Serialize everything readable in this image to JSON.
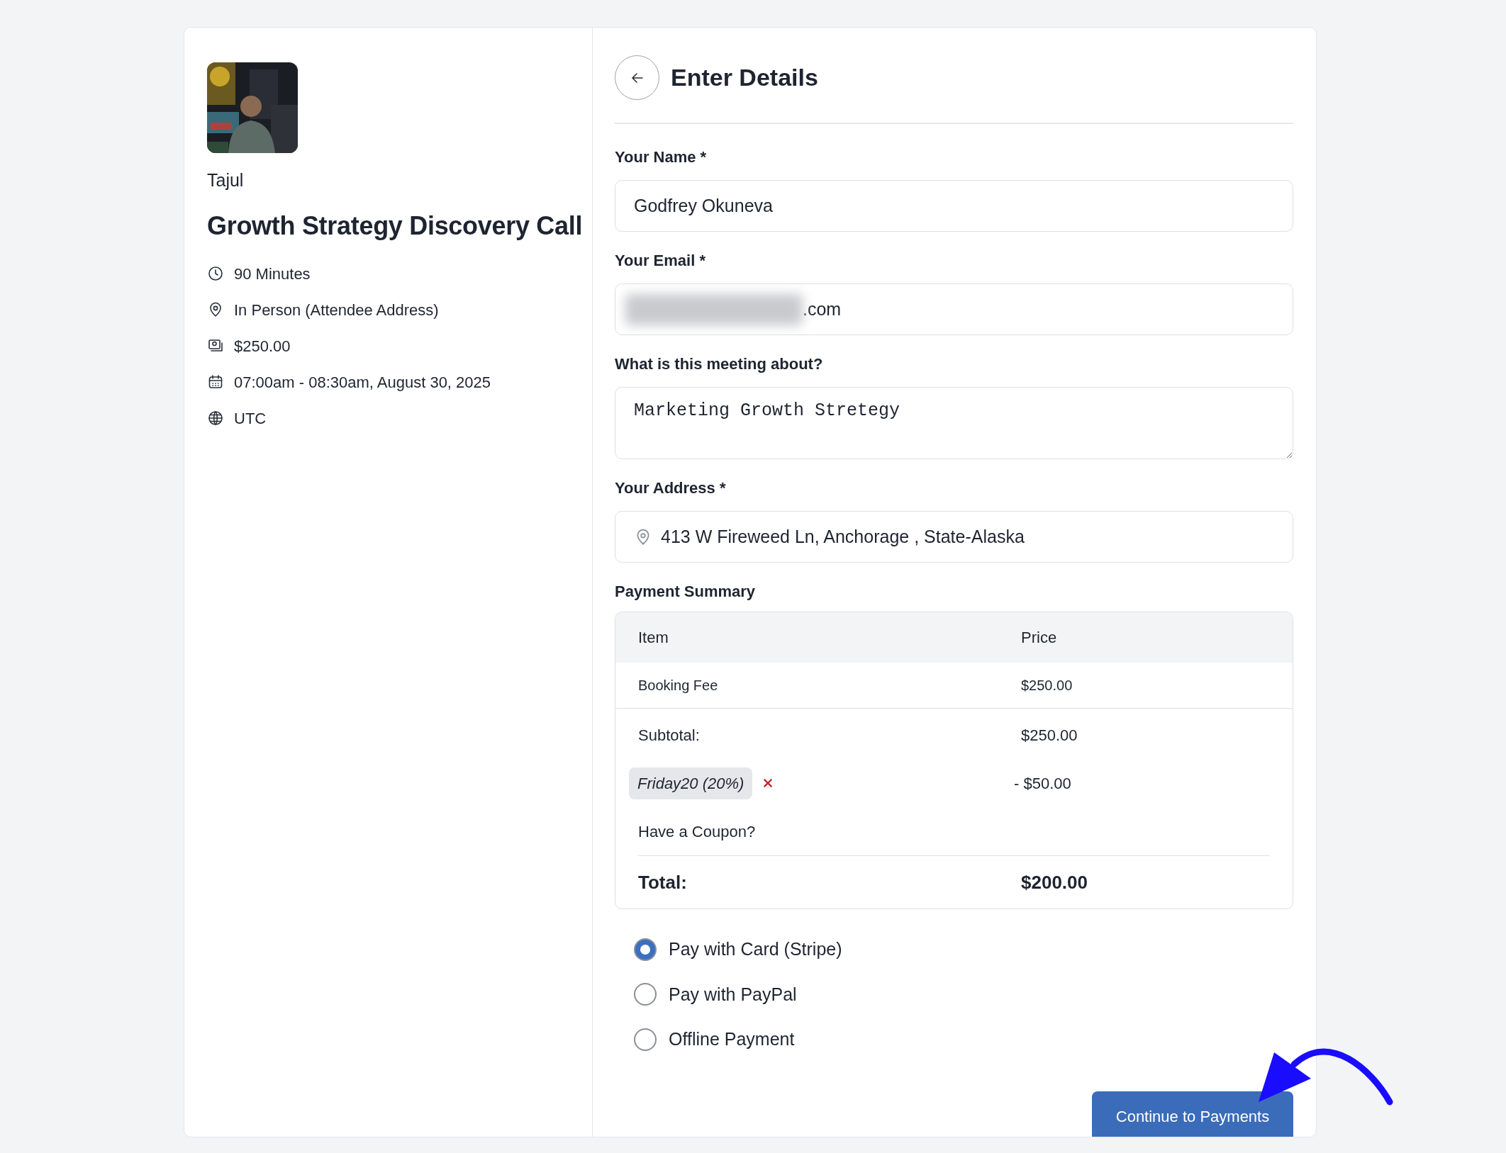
{
  "host": {
    "name": "Tajul"
  },
  "event": {
    "title": "Growth Strategy Discovery Call",
    "details": [
      {
        "kind": "duration",
        "text": "90 Minutes"
      },
      {
        "kind": "location",
        "text": "In Person (Attendee Address)"
      },
      {
        "kind": "price",
        "text": "$250.00"
      },
      {
        "kind": "date",
        "text": "07:00am - 08:30am, August 30, 2025"
      },
      {
        "kind": "timezone",
        "text": "UTC"
      }
    ]
  },
  "form": {
    "title": "Enter Details",
    "fields": [
      {
        "kind": "input",
        "label": "Your Name *",
        "value": "Godfrey Okuneva"
      },
      {
        "kind": "input",
        "label": "Your Email *",
        "value": ".com",
        "redacted": true
      },
      {
        "kind": "textarea",
        "label": "What is this meeting about?",
        "value": "Marketing Growth Stretegy"
      },
      {
        "kind": "address",
        "label": "Your Address *",
        "value": "413 W Fireweed Ln, Anchorage , State-Alaska"
      }
    ]
  },
  "payment_summary": {
    "title": "Payment Summary",
    "columns": [
      "Item",
      "Price"
    ],
    "rows": [
      [
        "Booking Fee",
        "$250.00"
      ]
    ],
    "subtotal": {
      "label": "Subtotal:",
      "value": "$250.00"
    },
    "coupon": {
      "code": "Friday20 (20%)",
      "discount": "- $50.00"
    },
    "coupon_link": "Have a Coupon?",
    "total": {
      "label": "Total:",
      "value": "$200.00"
    }
  },
  "payment_methods": [
    {
      "label": "Pay with Card (Stripe)",
      "selected": true
    },
    {
      "label": "Pay with PayPal",
      "selected": false
    },
    {
      "label": "Offline Payment",
      "selected": false
    }
  ],
  "submit_button": "Continue to Payments"
}
